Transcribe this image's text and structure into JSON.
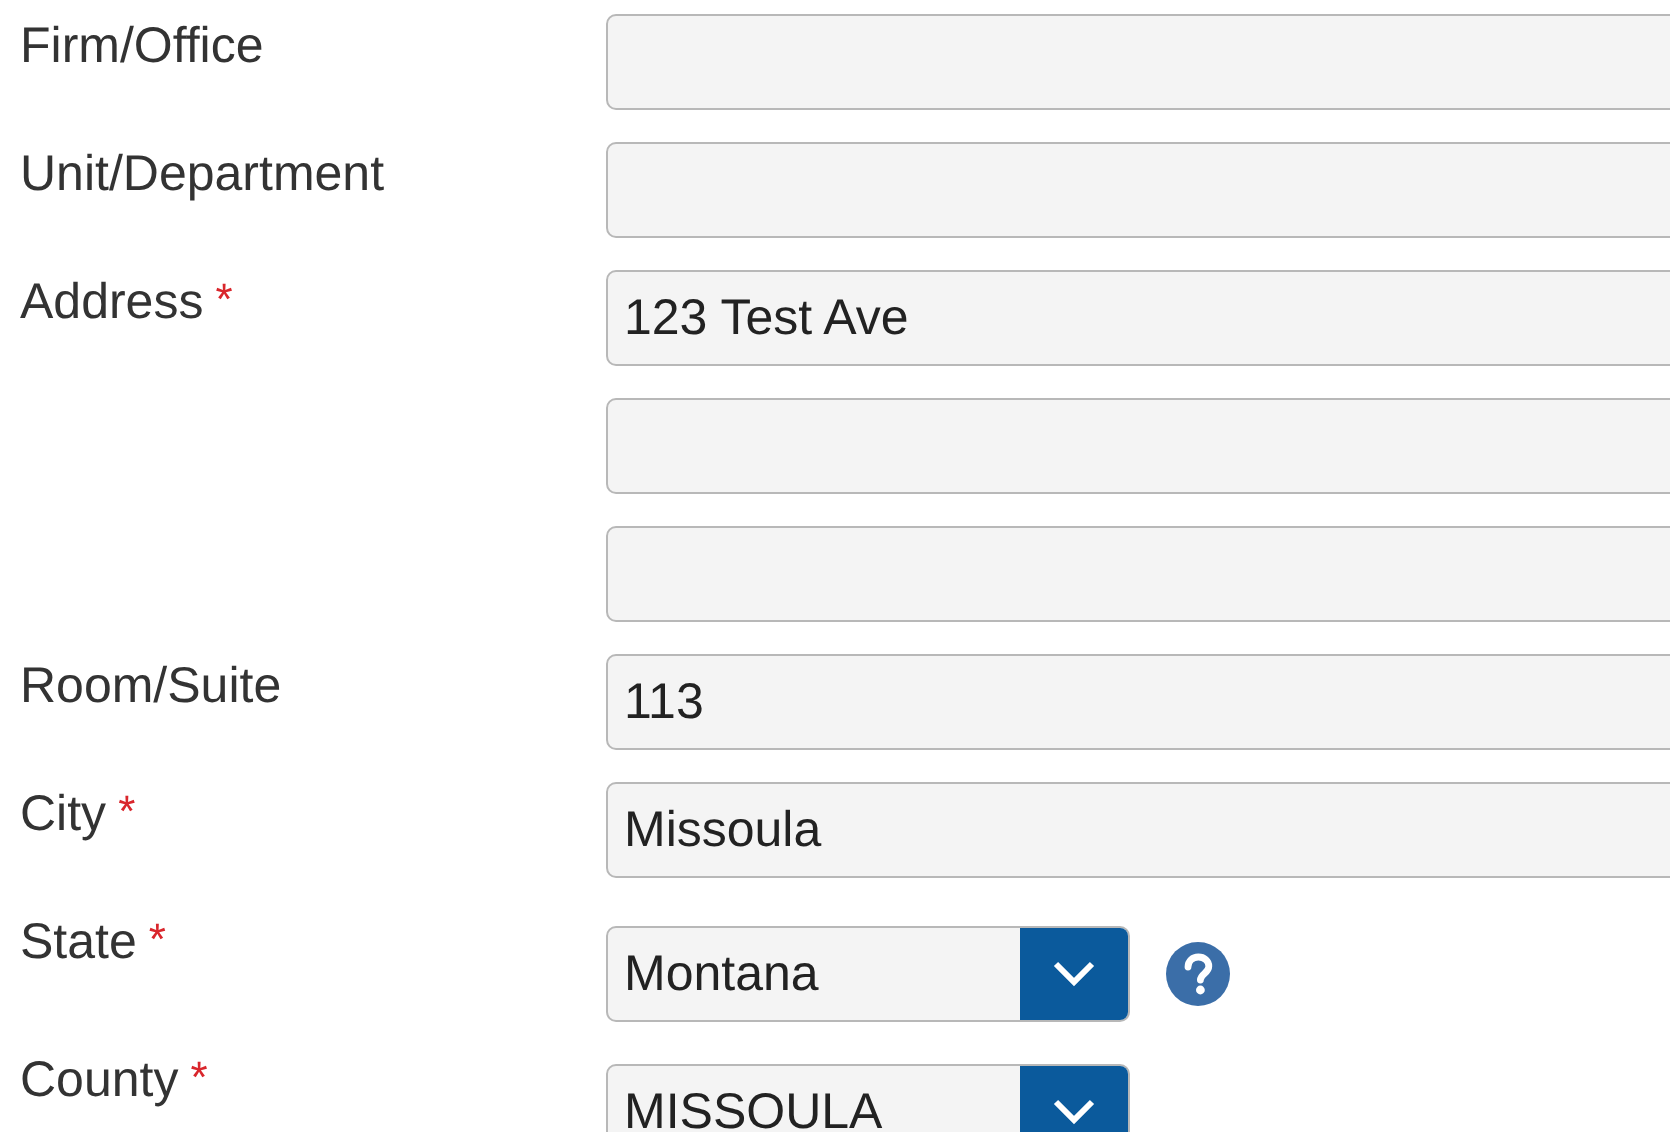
{
  "fields": [
    {
      "label": "Firm/Office",
      "kind": "text"
    },
    {
      "label": "Unit/Department",
      "kind": "text"
    },
    {
      "label": "Address",
      "required_mark": "*",
      "kind": "text",
      "value": "123 Test Ave"
    },
    {
      "kind": "text"
    },
    {
      "kind": "text"
    },
    {
      "label": "Room/Suite",
      "kind": "text",
      "value": "113"
    },
    {
      "label": "City",
      "required_mark": "*",
      "kind": "text",
      "value": "Missoula"
    },
    {
      "label": "State",
      "required_mark": "*",
      "kind": "select",
      "value": "Montana",
      "help": true
    },
    {
      "label": "County",
      "required_mark": "*",
      "kind": "select",
      "value": "MISSOULA"
    }
  ]
}
